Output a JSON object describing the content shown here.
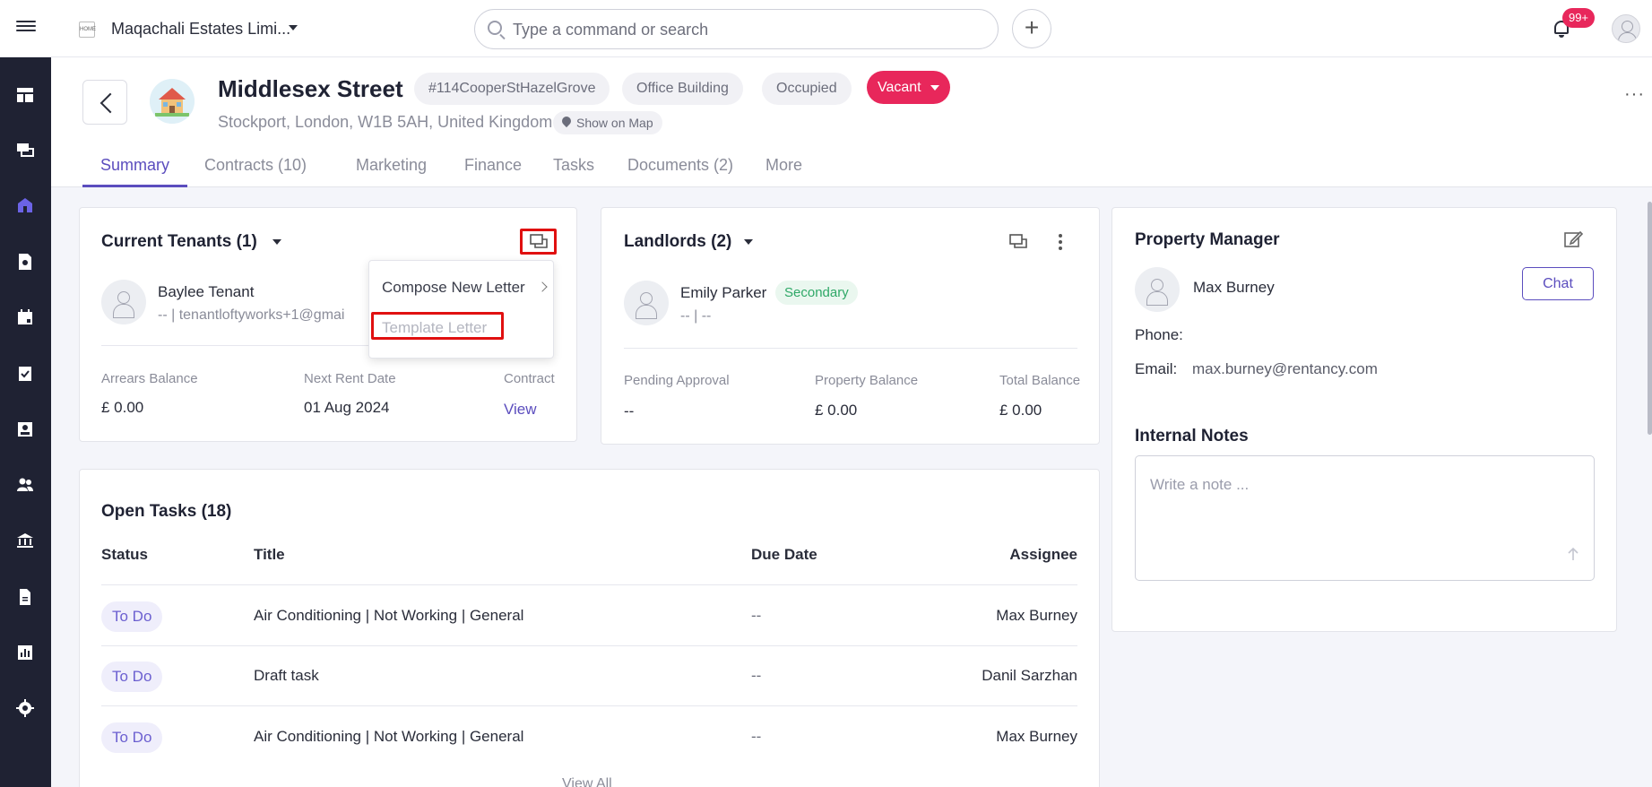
{
  "topbar": {
    "org_logo_text": "HOME",
    "org_name": "Maqachali Estates Limi...",
    "search_placeholder": "Type a command or search",
    "add_label": "+",
    "notifications_badge": "99+"
  },
  "property": {
    "title": "Middlesex Street",
    "reference": "#114CooperStHazelGrove",
    "type": "Office Building",
    "occupancy": "Occupied",
    "status": "Vacant",
    "address": "Stockport, London, W1B 5AH, United Kingdom",
    "map_label": "Show on Map",
    "more_label": "···"
  },
  "tabs": [
    {
      "label": "Summary"
    },
    {
      "label": "Contracts (10)"
    },
    {
      "label": "Marketing"
    },
    {
      "label": "Finance"
    },
    {
      "label": "Tasks"
    },
    {
      "label": "Documents (2)"
    },
    {
      "label": "More"
    }
  ],
  "tenants": {
    "title": "Current Tenants (1)",
    "tenant_name": "Baylee Tenant",
    "tenant_contact": "-- | tenantloftyworks+1@gmai",
    "arrears_label": "Arrears Balance",
    "arrears_value": "£ 0.00",
    "next_rent_label": "Next Rent Date",
    "next_rent_value": "01 Aug 2024",
    "contract_label": "Contract",
    "contract_link": "View"
  },
  "dropdown": {
    "compose": "Compose New Letter",
    "template": "Template Letter"
  },
  "landlords": {
    "title": "Landlords (2)",
    "landlord_name": "Emily Parker",
    "landlord_badge": "Secondary",
    "landlord_contact": "-- | --",
    "pending_label": "Pending Approval",
    "pending_value": "--",
    "property_balance_label": "Property Balance",
    "property_balance_value": "£ 0.00",
    "total_balance_label": "Total Balance",
    "total_balance_value": "£ 0.00"
  },
  "manager": {
    "title": "Property Manager",
    "name": "Max Burney",
    "chat_label": "Chat",
    "phone_label": "Phone:",
    "email_label": "Email:",
    "email_value": "max.burney@rentancy.com",
    "notes_title": "Internal Notes",
    "notes_placeholder": "Write a note ..."
  },
  "tasks": {
    "title": "Open Tasks (18)",
    "columns": [
      "Status",
      "Title",
      "Due Date",
      "Assignee"
    ],
    "rows": [
      {
        "status": "To Do",
        "title": "Air Conditioning | Not Working | General",
        "due": "--",
        "assignee": "Max Burney"
      },
      {
        "status": "To Do",
        "title": "Draft task",
        "due": "--",
        "assignee": "Danil Sarzhan"
      },
      {
        "status": "To Do",
        "title": "Air Conditioning | Not Working | General",
        "due": "--",
        "assignee": "Max Burney"
      }
    ],
    "view_all": "View All"
  },
  "colors": {
    "accent": "#5b4dbe",
    "sidebar": "#1f2233",
    "vacant": "#e8275b",
    "highlight": "#e01010",
    "secondary": "#2fa867"
  }
}
